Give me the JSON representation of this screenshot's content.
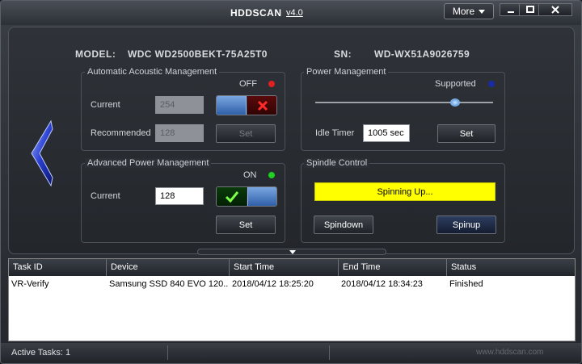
{
  "app": {
    "title": "HDDSCAN",
    "version": "v4.0",
    "more_label": "More"
  },
  "drive": {
    "model_label": "MODEL:",
    "model": "WDC WD2500BEKT-75A25T0",
    "sn_label": "SN:",
    "sn": "WD-WX51A9026759"
  },
  "aam": {
    "title": "Automatic Acoustic Management",
    "state": "OFF",
    "state_color": "#e02020",
    "current_label": "Current",
    "current_value": "254",
    "recommended_label": "Recommended",
    "recommended_value": "128",
    "set_label": "Set"
  },
  "power": {
    "title": "Power Management",
    "state": "Supported",
    "state_color": "#1a2aa0",
    "idle_label": "Idle Timer",
    "idle_value": "1005 sec",
    "set_label": "Set"
  },
  "apm": {
    "title": "Advanced Power Management",
    "state": "ON",
    "state_color": "#20d020",
    "current_label": "Current",
    "current_value": "128",
    "set_label": "Set"
  },
  "spindle": {
    "title": "Spindle Control",
    "status": "Spinning Up...",
    "spindown_label": "Spindown",
    "spinup_label": "Spinup"
  },
  "table": {
    "columns": [
      "Task ID",
      "Device",
      "Start Time",
      "End Time",
      "Status"
    ],
    "rows": [
      [
        "VR-Verify",
        "Samsung SSD 840 EVO 120...",
        "2018/04/12 18:25:20",
        "2018/04/12 18:34:23",
        "Finished"
      ]
    ]
  },
  "statusbar": {
    "active_tasks": "Active Tasks: 1",
    "url": "www.hddscan.com"
  }
}
